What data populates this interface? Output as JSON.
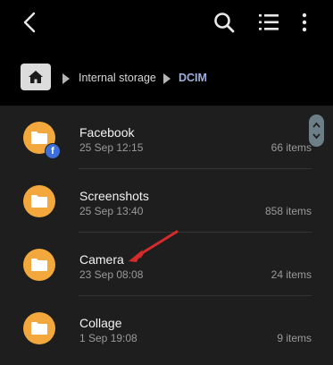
{
  "toolbar": {
    "icons": [
      "back-icon",
      "search-icon",
      "list-view-icon",
      "more-options-icon"
    ]
  },
  "path": {
    "home_icon": "home-icon",
    "crumbs": [
      "Internal storage",
      "DCIM"
    ],
    "active_crumb_color": "#9fb0e0"
  },
  "folders": [
    {
      "name": "Facebook",
      "date": "25 Sep 12:15",
      "count": "66 items",
      "badge": "f"
    },
    {
      "name": "Screenshots",
      "date": "25 Sep 13:40",
      "count": "858 items"
    },
    {
      "name": "Camera",
      "date": "23 Sep 08:08",
      "count": "24 items"
    },
    {
      "name": "Collage",
      "date": "1 Sep 19:08",
      "count": "9 items"
    }
  ],
  "colors": {
    "folder": "#f2a83c",
    "annotation_arrow": "#d62b2b",
    "facebook_badge": "#3b6fd9"
  }
}
